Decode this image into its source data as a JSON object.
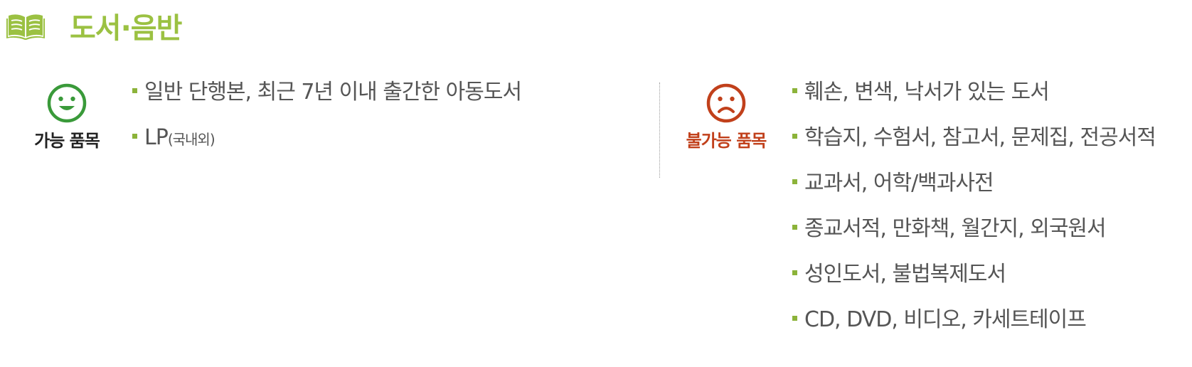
{
  "header": {
    "icon": "book-icon",
    "title": "도서·음반",
    "color": "#9bc142"
  },
  "allowed": {
    "icon": "smile-face-icon",
    "label": "가능 품목",
    "icon_color": "#3a9a3a",
    "items": [
      {
        "text": "일반 단행본, 최근 7년 이내 출간한 아동도서",
        "small": ""
      },
      {
        "text": "LP",
        "small": "(국내외)"
      }
    ]
  },
  "denied": {
    "icon": "frown-face-icon",
    "label": "불가능 품목",
    "icon_color": "#c1401b",
    "items": [
      {
        "text": "훼손, 변색, 낙서가 있는 도서"
      },
      {
        "text": "학습지, 수험서, 참고서, 문제집, 전공서적"
      },
      {
        "text": "교과서, 어학/백과사전"
      },
      {
        "text": "종교서적, 만화책, 월간지, 외국원서"
      },
      {
        "text": "성인도서, 불법복제도서"
      },
      {
        "text": "CD, DVD, 비디오, 카세트테이프"
      }
    ]
  },
  "bullet_color": "#8cb33a"
}
